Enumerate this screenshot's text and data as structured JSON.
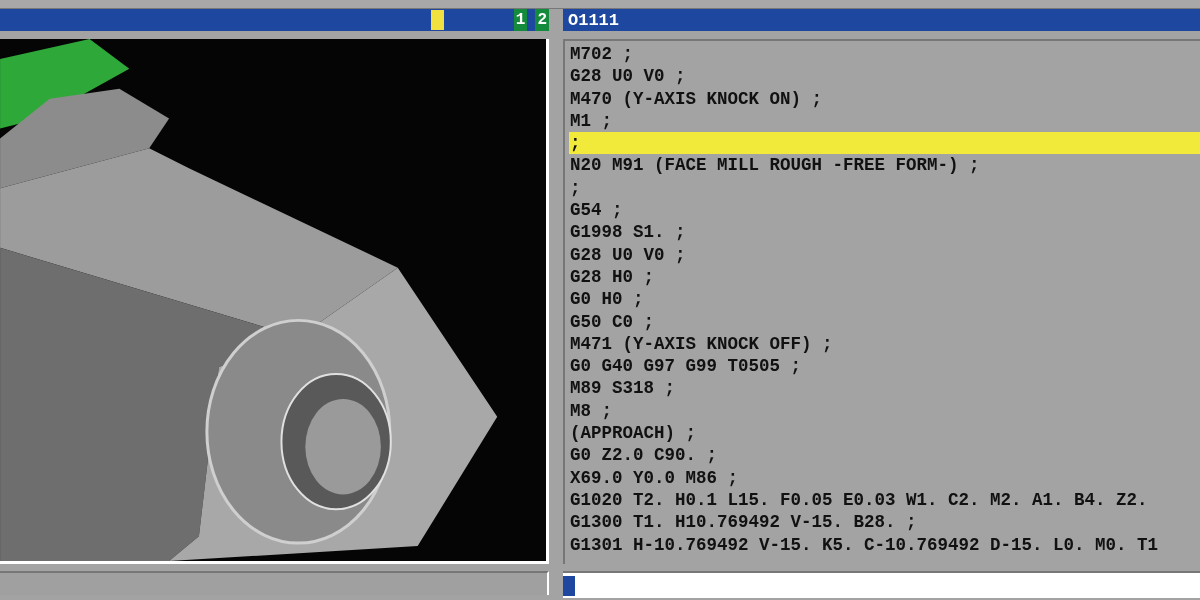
{
  "left_header": {
    "markers": [
      "1",
      "2"
    ]
  },
  "program": {
    "title": "O1111",
    "lines": [
      {
        "text": "M702 ;",
        "selected": false
      },
      {
        "text": "G28 U0 V0 ;",
        "selected": false
      },
      {
        "text": "M470 (Y-AXIS KNOCK ON) ;",
        "selected": false
      },
      {
        "text": "M1 ;",
        "selected": false
      },
      {
        "text": ";",
        "selected": true
      },
      {
        "text": "N20 M91 (FACE MILL ROUGH -FREE FORM-) ;",
        "selected": false
      },
      {
        "text": ";",
        "selected": false
      },
      {
        "text": "G54 ;",
        "selected": false
      },
      {
        "text": "G1998 S1. ;",
        "selected": false
      },
      {
        "text": "G28 U0 V0 ;",
        "selected": false
      },
      {
        "text": "G28 H0 ;",
        "selected": false
      },
      {
        "text": "G0 H0 ;",
        "selected": false
      },
      {
        "text": "G50 C0 ;",
        "selected": false
      },
      {
        "text": "M471 (Y-AXIS KNOCK OFF) ;",
        "selected": false
      },
      {
        "text": "G0 G40 G97 G99 T0505 ;",
        "selected": false
      },
      {
        "text": "M89 S318 ;",
        "selected": false
      },
      {
        "text": "M8 ;",
        "selected": false
      },
      {
        "text": "(APPROACH) ;",
        "selected": false
      },
      {
        "text": "G0 Z2.0 C90. ;",
        "selected": false
      },
      {
        "text": "X69.0 Y0.0 M86 ;",
        "selected": false
      },
      {
        "text": "G1020 T2. H0.1 L15. F0.05 E0.03 W1. C2. M2. A1. B4. Z2.",
        "selected": false
      },
      {
        "text": "G1300 T1. H10.769492 V-15. B28. ;",
        "selected": false
      },
      {
        "text": "G1301 H-10.769492 V-15. K5. C-10.769492 D-15. L0. M0. T1",
        "selected": false
      }
    ]
  }
}
